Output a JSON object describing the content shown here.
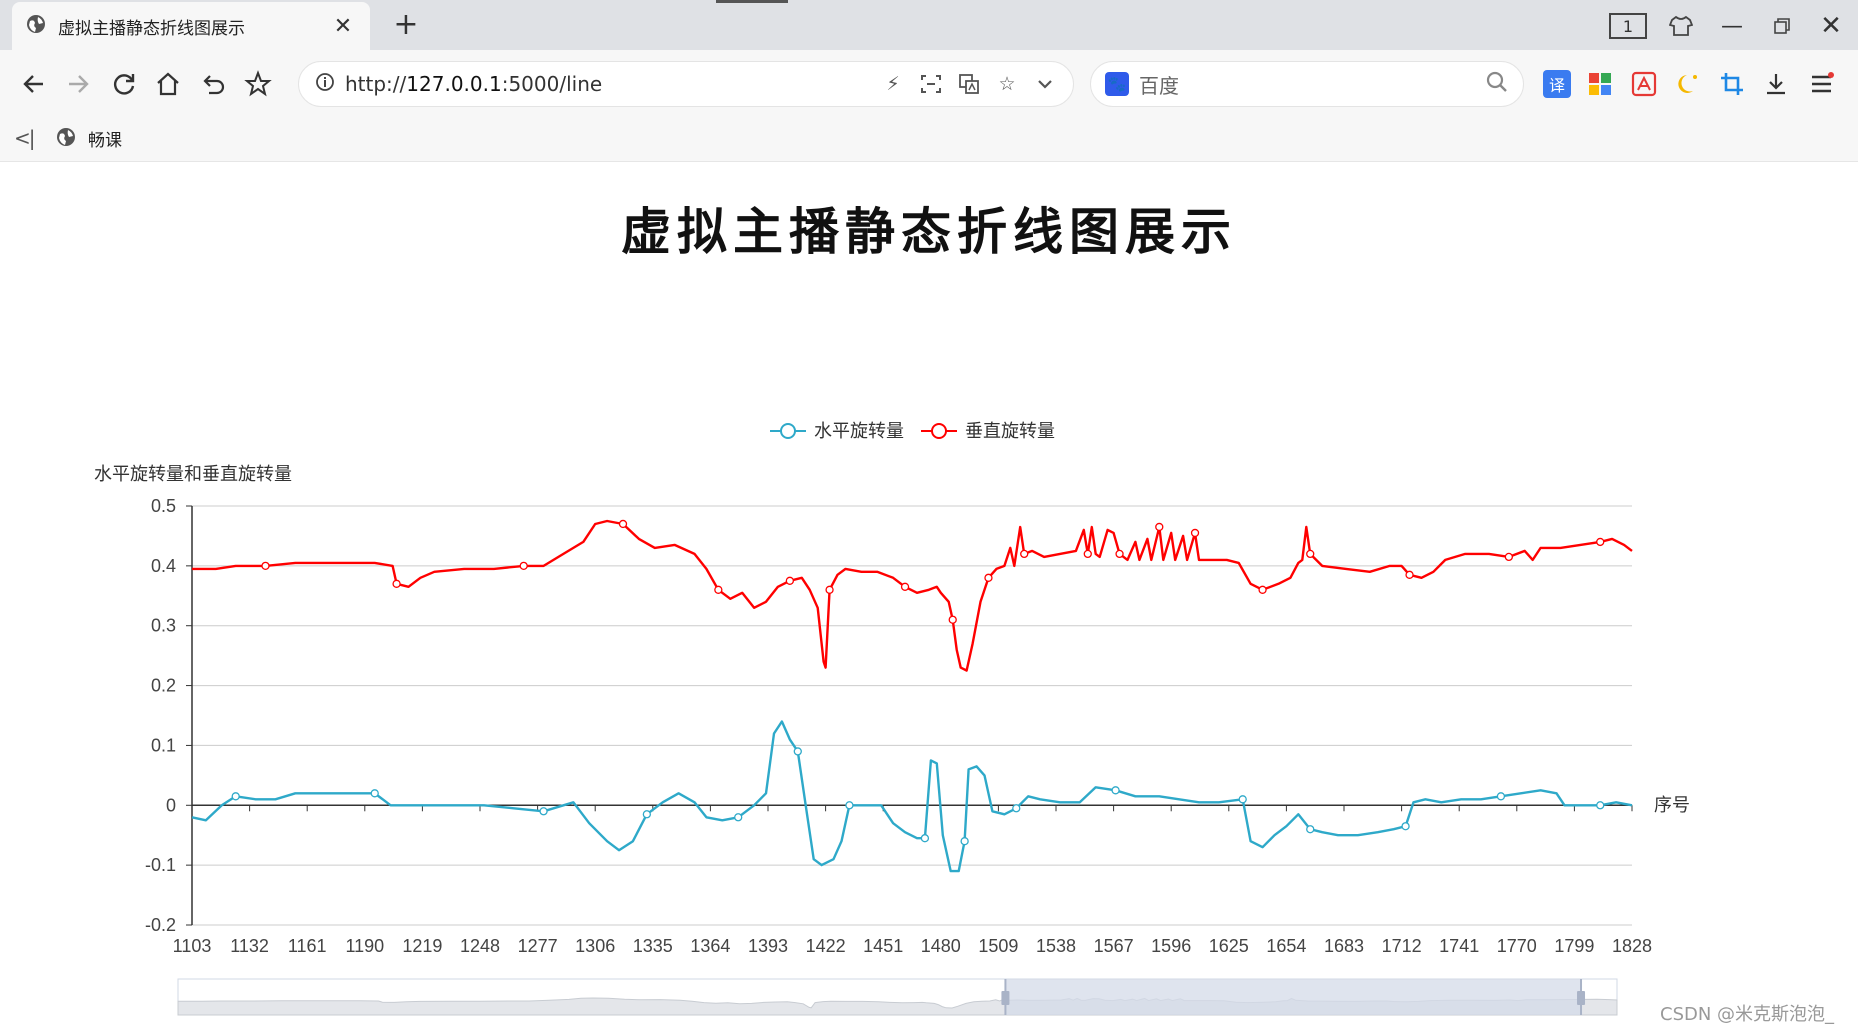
{
  "browser": {
    "tab_title": "虚拟主播静态折线图展示",
    "tab_count": "1",
    "url_prefix": "http://",
    "url_host": "127.0.0.1",
    "url_rest": ":5000/line",
    "search_placeholder": "百度",
    "bookmark_label": "畅课",
    "extension_translate_label": "译"
  },
  "page": {
    "title": "虚拟主播静态折线图展示"
  },
  "watermark": "CSDN @米克斯泡泡_",
  "colors": {
    "horizontal": "#2ea9c9",
    "vertical": "#ff0000",
    "axis": "#333333",
    "grid": "#cccccc",
    "dataZoomFill": "#d4dbe8"
  },
  "chart_data": {
    "type": "line",
    "title": "",
    "ylabel": "水平旋转量和垂直旋转量",
    "xlabel": "序号",
    "ylim": [
      -0.2,
      0.5
    ],
    "y_ticks": [
      "0.5",
      "0.4",
      "0.3",
      "0.2",
      "0.1",
      "0",
      "-0.1",
      "-0.2"
    ],
    "x_tick_labels": [
      "1103",
      "1132",
      "1161",
      "1190",
      "1219",
      "1248",
      "1277",
      "1306",
      "1335",
      "1364",
      "1393",
      "1422",
      "1451",
      "1480",
      "1509",
      "1538",
      "1567",
      "1596",
      "1625",
      "1654",
      "1683",
      "1712",
      "1741",
      "1770",
      "1799",
      "1828"
    ],
    "legend_position": "top-center",
    "grid": "horizontal",
    "series": [
      {
        "name": "水平旋转量",
        "points": [
          [
            1103,
            -0.02
          ],
          [
            1110,
            -0.025
          ],
          [
            1118,
            0.0
          ],
          [
            1125,
            0.015
          ],
          [
            1135,
            0.01
          ],
          [
            1145,
            0.01
          ],
          [
            1155,
            0.02
          ],
          [
            1170,
            0.02
          ],
          [
            1185,
            0.02
          ],
          [
            1195,
            0.02
          ],
          [
            1203,
            0.0
          ],
          [
            1215,
            0.0
          ],
          [
            1230,
            0.0
          ],
          [
            1250,
            0.0
          ],
          [
            1265,
            -0.005
          ],
          [
            1280,
            -0.01
          ],
          [
            1295,
            0.005
          ],
          [
            1303,
            -0.03
          ],
          [
            1312,
            -0.06
          ],
          [
            1318,
            -0.075
          ],
          [
            1325,
            -0.06
          ],
          [
            1332,
            -0.015
          ],
          [
            1340,
            0.005
          ],
          [
            1348,
            0.02
          ],
          [
            1356,
            0.005
          ],
          [
            1362,
            -0.02
          ],
          [
            1370,
            -0.025
          ],
          [
            1378,
            -0.02
          ],
          [
            1386,
            0.0
          ],
          [
            1392,
            0.02
          ],
          [
            1396,
            0.12
          ],
          [
            1400,
            0.14
          ],
          [
            1404,
            0.11
          ],
          [
            1408,
            0.09
          ],
          [
            1412,
            0.0
          ],
          [
            1416,
            -0.09
          ],
          [
            1420,
            -0.1
          ],
          [
            1426,
            -0.09
          ],
          [
            1430,
            -0.06
          ],
          [
            1434,
            0.0
          ],
          [
            1442,
            0.0
          ],
          [
            1450,
            0.0
          ],
          [
            1456,
            -0.03
          ],
          [
            1462,
            -0.045
          ],
          [
            1468,
            -0.055
          ],
          [
            1472,
            -0.055
          ],
          [
            1475,
            0.075
          ],
          [
            1478,
            0.07
          ],
          [
            1481,
            -0.05
          ],
          [
            1485,
            -0.11
          ],
          [
            1489,
            -0.11
          ],
          [
            1492,
            -0.06
          ],
          [
            1494,
            0.06
          ],
          [
            1498,
            0.065
          ],
          [
            1502,
            0.05
          ],
          [
            1506,
            -0.01
          ],
          [
            1512,
            -0.015
          ],
          [
            1518,
            -0.005
          ],
          [
            1524,
            0.015
          ],
          [
            1530,
            0.01
          ],
          [
            1540,
            0.005
          ],
          [
            1550,
            0.005
          ],
          [
            1558,
            0.03
          ],
          [
            1568,
            0.025
          ],
          [
            1578,
            0.015
          ],
          [
            1590,
            0.015
          ],
          [
            1600,
            0.01
          ],
          [
            1610,
            0.005
          ],
          [
            1620,
            0.005
          ],
          [
            1632,
            0.01
          ],
          [
            1636,
            -0.06
          ],
          [
            1642,
            -0.07
          ],
          [
            1648,
            -0.05
          ],
          [
            1654,
            -0.035
          ],
          [
            1660,
            -0.015
          ],
          [
            1666,
            -0.04
          ],
          [
            1672,
            -0.045
          ],
          [
            1680,
            -0.05
          ],
          [
            1690,
            -0.05
          ],
          [
            1700,
            -0.045
          ],
          [
            1708,
            -0.04
          ],
          [
            1714,
            -0.035
          ],
          [
            1718,
            0.005
          ],
          [
            1724,
            0.01
          ],
          [
            1732,
            0.005
          ],
          [
            1742,
            0.01
          ],
          [
            1752,
            0.01
          ],
          [
            1762,
            0.015
          ],
          [
            1772,
            0.02
          ],
          [
            1782,
            0.025
          ],
          [
            1790,
            0.02
          ],
          [
            1794,
            0.0
          ],
          [
            1802,
            0.0
          ],
          [
            1812,
            0.0
          ],
          [
            1820,
            0.005
          ],
          [
            1828,
            0.0
          ]
        ]
      },
      {
        "name": "垂直旋转量",
        "points": [
          [
            1103,
            0.395
          ],
          [
            1115,
            0.395
          ],
          [
            1125,
            0.4
          ],
          [
            1140,
            0.4
          ],
          [
            1155,
            0.405
          ],
          [
            1165,
            0.405
          ],
          [
            1180,
            0.405
          ],
          [
            1195,
            0.405
          ],
          [
            1204,
            0.4
          ],
          [
            1206,
            0.37
          ],
          [
            1212,
            0.365
          ],
          [
            1218,
            0.38
          ],
          [
            1225,
            0.39
          ],
          [
            1240,
            0.395
          ],
          [
            1255,
            0.395
          ],
          [
            1270,
            0.4
          ],
          [
            1280,
            0.4
          ],
          [
            1290,
            0.42
          ],
          [
            1300,
            0.44
          ],
          [
            1306,
            0.47
          ],
          [
            1312,
            0.475
          ],
          [
            1320,
            0.47
          ],
          [
            1328,
            0.445
          ],
          [
            1336,
            0.43
          ],
          [
            1346,
            0.435
          ],
          [
            1356,
            0.42
          ],
          [
            1362,
            0.395
          ],
          [
            1368,
            0.36
          ],
          [
            1374,
            0.345
          ],
          [
            1380,
            0.355
          ],
          [
            1386,
            0.33
          ],
          [
            1392,
            0.34
          ],
          [
            1398,
            0.365
          ],
          [
            1404,
            0.375
          ],
          [
            1410,
            0.38
          ],
          [
            1414,
            0.36
          ],
          [
            1418,
            0.33
          ],
          [
            1421,
            0.24
          ],
          [
            1422,
            0.23
          ],
          [
            1424,
            0.36
          ],
          [
            1428,
            0.385
          ],
          [
            1432,
            0.395
          ],
          [
            1440,
            0.39
          ],
          [
            1448,
            0.39
          ],
          [
            1456,
            0.38
          ],
          [
            1462,
            0.365
          ],
          [
            1468,
            0.355
          ],
          [
            1474,
            0.36
          ],
          [
            1478,
            0.365
          ],
          [
            1480,
            0.355
          ],
          [
            1484,
            0.34
          ],
          [
            1486,
            0.31
          ],
          [
            1488,
            0.26
          ],
          [
            1490,
            0.23
          ],
          [
            1493,
            0.225
          ],
          [
            1496,
            0.27
          ],
          [
            1500,
            0.34
          ],
          [
            1504,
            0.38
          ],
          [
            1508,
            0.395
          ],
          [
            1512,
            0.4
          ],
          [
            1515,
            0.43
          ],
          [
            1517,
            0.4
          ],
          [
            1520,
            0.465
          ],
          [
            1522,
            0.42
          ],
          [
            1526,
            0.425
          ],
          [
            1532,
            0.415
          ],
          [
            1540,
            0.42
          ],
          [
            1548,
            0.425
          ],
          [
            1552,
            0.46
          ],
          [
            1554,
            0.42
          ],
          [
            1556,
            0.465
          ],
          [
            1558,
            0.42
          ],
          [
            1560,
            0.415
          ],
          [
            1564,
            0.46
          ],
          [
            1567,
            0.455
          ],
          [
            1570,
            0.42
          ],
          [
            1574,
            0.41
          ],
          [
            1578,
            0.44
          ],
          [
            1580,
            0.41
          ],
          [
            1584,
            0.445
          ],
          [
            1586,
            0.41
          ],
          [
            1590,
            0.465
          ],
          [
            1592,
            0.41
          ],
          [
            1596,
            0.455
          ],
          [
            1598,
            0.41
          ],
          [
            1602,
            0.45
          ],
          [
            1604,
            0.41
          ],
          [
            1608,
            0.455
          ],
          [
            1610,
            0.41
          ],
          [
            1616,
            0.41
          ],
          [
            1624,
            0.41
          ],
          [
            1630,
            0.405
          ],
          [
            1636,
            0.37
          ],
          [
            1642,
            0.36
          ],
          [
            1650,
            0.37
          ],
          [
            1656,
            0.38
          ],
          [
            1660,
            0.405
          ],
          [
            1662,
            0.41
          ],
          [
            1664,
            0.465
          ],
          [
            1666,
            0.42
          ],
          [
            1672,
            0.4
          ],
          [
            1684,
            0.395
          ],
          [
            1696,
            0.39
          ],
          [
            1706,
            0.4
          ],
          [
            1712,
            0.4
          ],
          [
            1716,
            0.385
          ],
          [
            1722,
            0.38
          ],
          [
            1728,
            0.39
          ],
          [
            1734,
            0.41
          ],
          [
            1744,
            0.42
          ],
          [
            1756,
            0.42
          ],
          [
            1766,
            0.415
          ],
          [
            1774,
            0.425
          ],
          [
            1778,
            0.41
          ],
          [
            1782,
            0.43
          ],
          [
            1792,
            0.43
          ],
          [
            1802,
            0.435
          ],
          [
            1812,
            0.44
          ],
          [
            1818,
            0.445
          ],
          [
            1824,
            0.435
          ],
          [
            1828,
            0.425
          ]
        ]
      }
    ],
    "data_zoom": {
      "start_percent": 57.5,
      "end_percent": 97.5
    }
  }
}
